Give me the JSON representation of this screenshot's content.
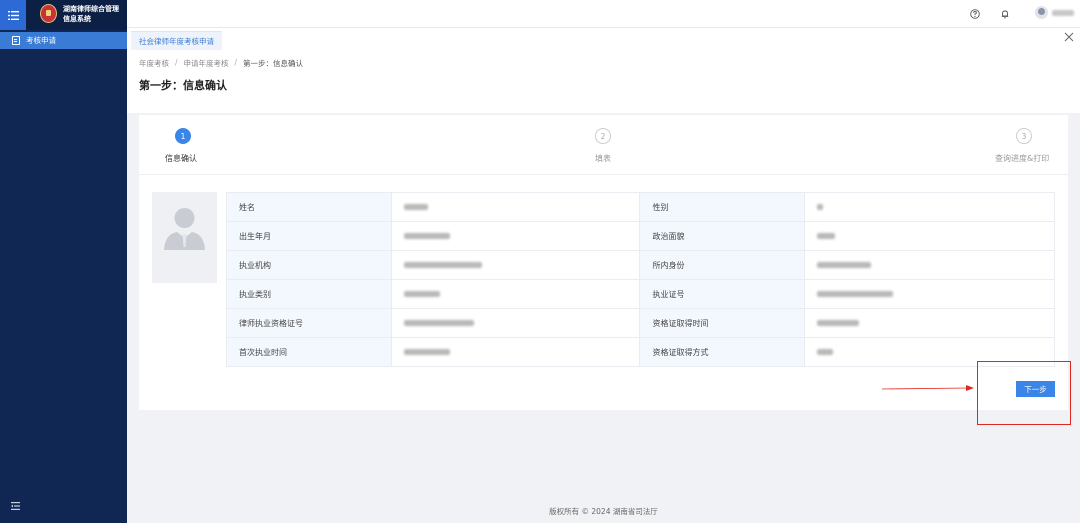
{
  "app": {
    "title": "湖南律师综合管理信息系统",
    "icons": {
      "menu": "menu-icon",
      "emblem": "national-emblem-icon",
      "help": "question-icon",
      "bell": "bell-icon",
      "close": "close-icon",
      "collapse": "collapse-icon"
    }
  },
  "sidebar": {
    "items": [
      {
        "label": "考核申请",
        "icon": "form-icon"
      }
    ]
  },
  "tabs": [
    {
      "label": "社会律师年度考核申请"
    }
  ],
  "breadcrumb": [
    "年度考核",
    "申请年度考核",
    "第一步：信息确认"
  ],
  "page": {
    "title": "第一步：信息确认"
  },
  "steps": [
    {
      "number": "1",
      "label": "信息确认",
      "status": "active"
    },
    {
      "number": "2",
      "label": "填表",
      "status": "todo"
    },
    {
      "number": "3",
      "label": "查询进度&打印",
      "status": "todo"
    }
  ],
  "info": {
    "rows": [
      {
        "left_label": "姓名",
        "right_label": "性别"
      },
      {
        "left_label": "出生年月",
        "right_label": "政治面貌"
      },
      {
        "left_label": "执业机构",
        "right_label": "所内身份"
      },
      {
        "left_label": "执业类别",
        "right_label": "执业证号"
      },
      {
        "left_label": "律师执业资格证号",
        "right_label": "资格证取得时间"
      },
      {
        "left_label": "首次执业时间",
        "right_label": "资格证取得方式"
      }
    ]
  },
  "actions": {
    "next_label": "下一步"
  },
  "footer": {
    "text": "版权所有 © 2024 湖南省司法厅"
  },
  "colors": {
    "sidebar": "#0f2752",
    "accent": "#3a86e8",
    "highlight": "#e0271f"
  }
}
